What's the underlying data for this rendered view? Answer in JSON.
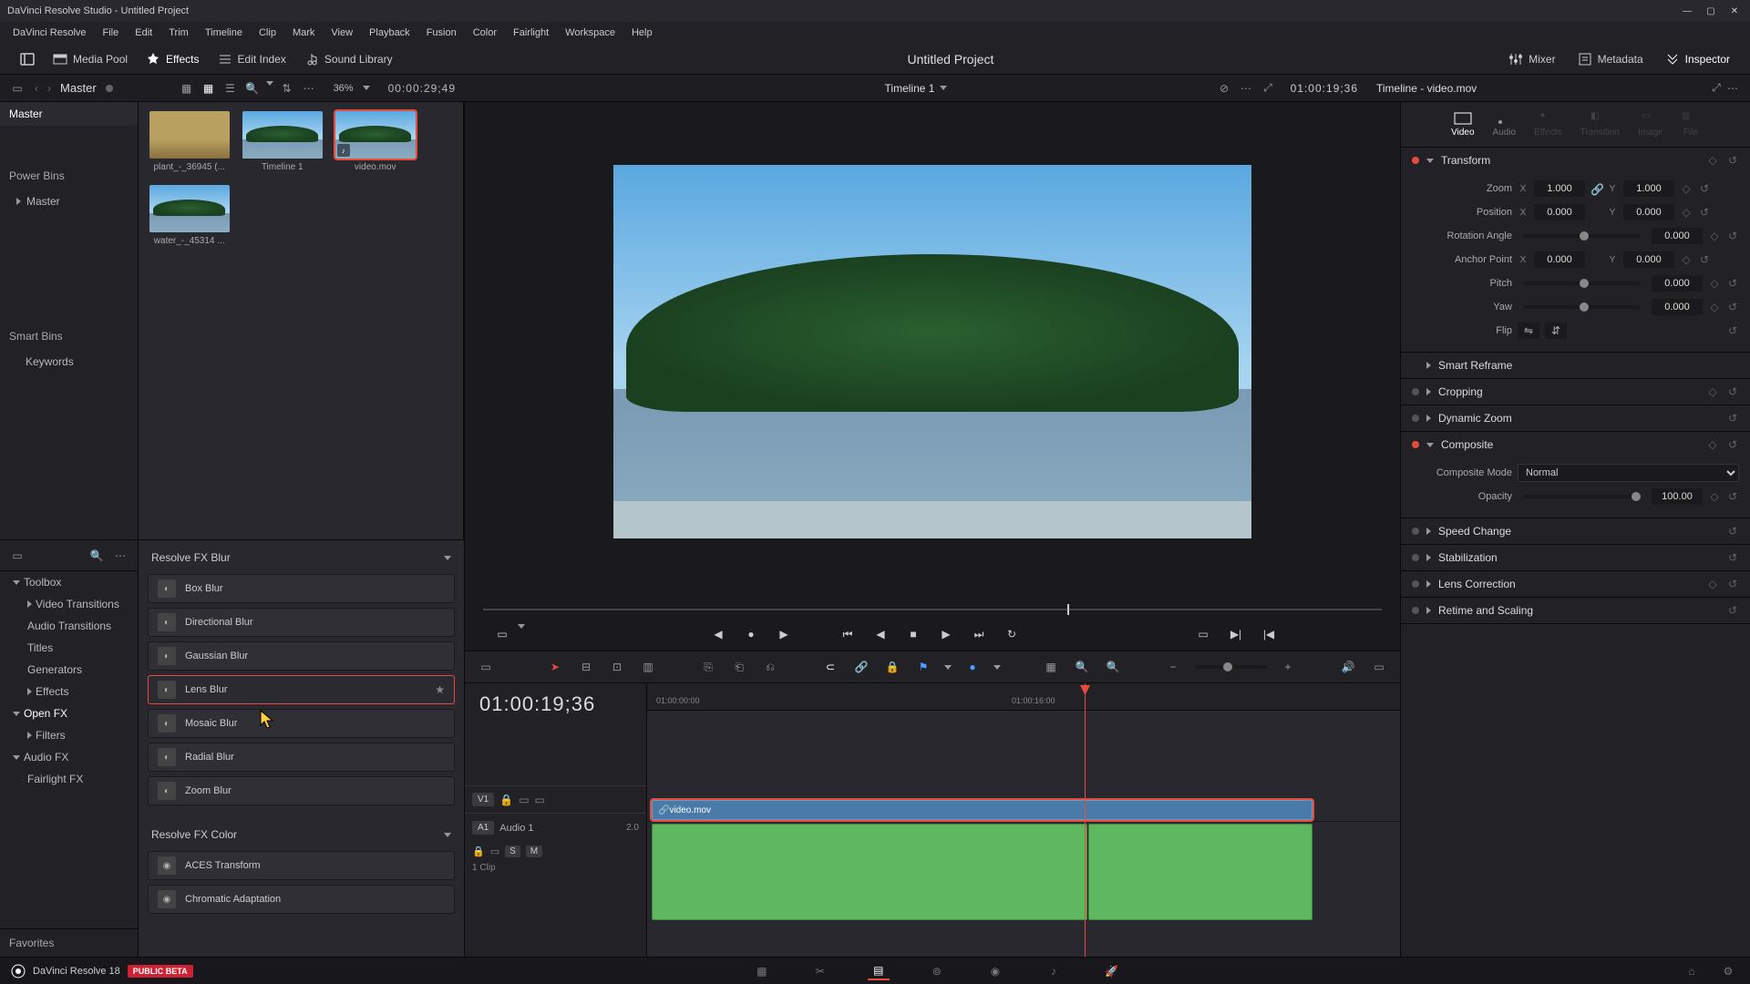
{
  "titlebar": {
    "title": "DaVinci Resolve Studio - Untitled Project"
  },
  "menubar": [
    "DaVinci Resolve",
    "File",
    "Edit",
    "Trim",
    "Timeline",
    "Clip",
    "Mark",
    "View",
    "Playback",
    "Fusion",
    "Color",
    "Fairlight",
    "Workspace",
    "Help"
  ],
  "toolbar": {
    "media_pool": "Media Pool",
    "effects": "Effects",
    "edit_index": "Edit Index",
    "sound_library": "Sound Library",
    "mixer": "Mixer",
    "metadata": "Metadata",
    "inspector": "Inspector",
    "project_title": "Untitled Project"
  },
  "subheader": {
    "master": "Master",
    "zoom": "36%",
    "duration_tc": "00:00:29;49",
    "timeline_name": "Timeline 1",
    "position_tc": "01:00:19;36",
    "inspector_title": "Timeline - video.mov"
  },
  "bins": {
    "master": "Master",
    "power_bins": "Power Bins",
    "power_master": "Master",
    "smart_bins": "Smart Bins",
    "keywords": "Keywords",
    "favorites": "Favorites"
  },
  "media": [
    {
      "label": "plant_-_36945 (...",
      "kind": "image",
      "sel": false
    },
    {
      "label": "Timeline 1",
      "kind": "timeline",
      "sel": false
    },
    {
      "label": "video.mov",
      "kind": "video",
      "sel": true
    },
    {
      "label": "water_-_45314 ...",
      "kind": "image",
      "sel": false
    }
  ],
  "fx_tree": {
    "toolbox": "Toolbox",
    "video_trans": "Video Transitions",
    "audio_trans": "Audio Transitions",
    "titles": "Titles",
    "generators": "Generators",
    "effects": "Effects",
    "open_fx": "Open FX",
    "filters": "Filters",
    "audio_fx": "Audio FX",
    "fairlight_fx": "Fairlight FX"
  },
  "fx_groups": [
    {
      "name": "Resolve FX Blur",
      "items": [
        "Box Blur",
        "Directional Blur",
        "Gaussian Blur",
        "Lens Blur",
        "Mosaic Blur",
        "Radial Blur",
        "Zoom Blur"
      ],
      "selected": "Lens Blur"
    },
    {
      "name": "Resolve FX Color",
      "items": [
        "ACES Transform",
        "Chromatic Adaptation"
      ]
    }
  ],
  "timeline": {
    "tc": "01:00:19;36",
    "ruler": [
      "01:00:00:00",
      "01:00:16:00"
    ],
    "v1": "V1",
    "a1": "A1",
    "audio_label": "Audio 1",
    "audio_ch": "2.0",
    "clip_count": "1 Clip",
    "clip_name": "video.mov"
  },
  "inspector": {
    "tabs": [
      "Video",
      "Audio",
      "Effects",
      "Transition",
      "Image",
      "File"
    ],
    "active_tab": "Video",
    "transform": {
      "title": "Transform",
      "zoom_label": "Zoom",
      "zoom_x": "1.000",
      "zoom_y": "1.000",
      "position_label": "Position",
      "pos_x": "0.000",
      "pos_y": "0.000",
      "rotation_label": "Rotation Angle",
      "rotation": "0.000",
      "anchor_label": "Anchor Point",
      "anchor_x": "0.000",
      "anchor_y": "0.000",
      "pitch_label": "Pitch",
      "pitch": "0.000",
      "yaw_label": "Yaw",
      "yaw": "0.000",
      "flip_label": "Flip"
    },
    "sections": {
      "smart_reframe": "Smart Reframe",
      "cropping": "Cropping",
      "dynamic_zoom": "Dynamic Zoom",
      "composite": "Composite",
      "composite_mode_label": "Composite Mode",
      "composite_mode": "Normal",
      "opacity_label": "Opacity",
      "opacity": "100.00",
      "speed_change": "Speed Change",
      "stabilization": "Stabilization",
      "lens_correction": "Lens Correction",
      "retime": "Retime and Scaling"
    }
  },
  "bottombar": {
    "app": "DaVinci Resolve 18",
    "beta": "PUBLIC BETA"
  },
  "track_buttons": {
    "s": "S",
    "m": "M"
  }
}
